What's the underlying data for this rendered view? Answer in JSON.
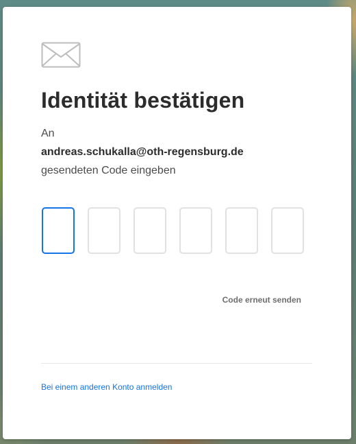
{
  "dialog": {
    "icon": "envelope-icon",
    "title": "Identität bestätigen",
    "instruction_prefix": "An",
    "email": "andreas.schukalla@oth-regensburg.de",
    "instruction_suffix": "gesendeten Code eingeben",
    "code_inputs": [
      {
        "value": "",
        "focused": true
      },
      {
        "value": "",
        "focused": false
      },
      {
        "value": "",
        "focused": false
      },
      {
        "value": "",
        "focused": false
      },
      {
        "value": "",
        "focused": false
      },
      {
        "value": "",
        "focused": false
      }
    ],
    "resend_label": "Code erneut senden",
    "other_account_label": "Bei einem anderen Konto anmelden"
  },
  "colors": {
    "accent": "#1473e6",
    "input_border": "#e1e1e1",
    "title_text": "#2c2c2c",
    "body_text": "#4b4b4b",
    "muted_text": "#6e6e6e"
  }
}
